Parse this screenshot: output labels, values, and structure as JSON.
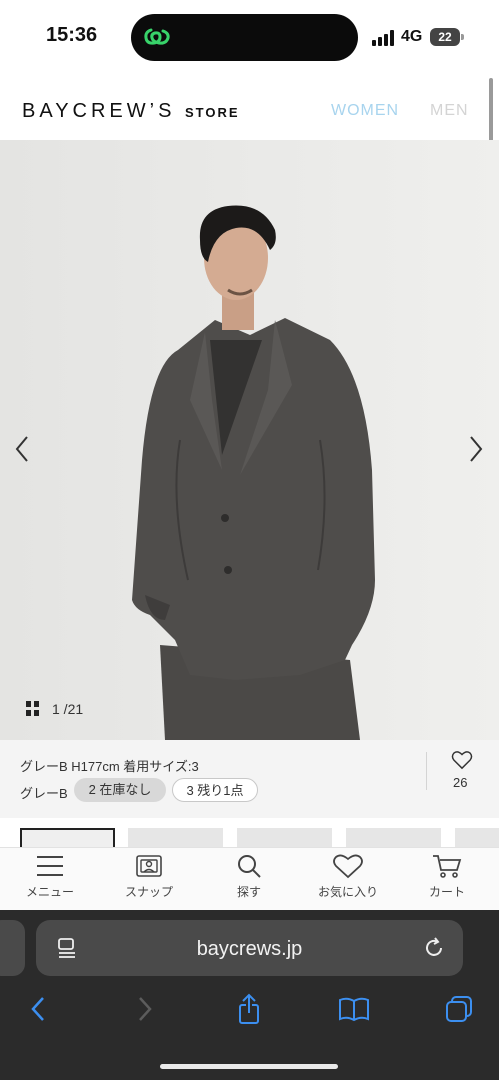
{
  "status_bar": {
    "time": "15:36",
    "network": "4G",
    "battery": "22"
  },
  "header": {
    "brand": "BAYCREW’S",
    "brand_suffix": "STORE",
    "nav": [
      "WOMEN",
      "MEN"
    ]
  },
  "gallery": {
    "counter": "1 /21"
  },
  "product_info": {
    "color_line": "グレーB H177cm 着用サイズ:3",
    "color_label": "グレーB",
    "size_chips": [
      "2 在庫なし",
      "3 残り1点"
    ],
    "like_count": "26"
  },
  "bottom_nav": [
    "メニュー",
    "スナップ",
    "探す",
    "お気に入り",
    "カート"
  ],
  "browser": {
    "url": "baycrews.jp"
  },
  "colors": {
    "women_link": "#a8d4ee",
    "men_link": "#d4d4d4",
    "jacket": "#4a4846",
    "background": "#e9e9e7"
  }
}
